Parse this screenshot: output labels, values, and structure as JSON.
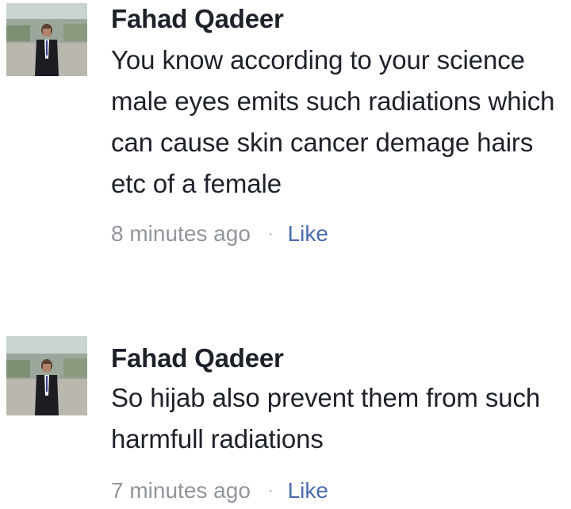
{
  "comments": [
    {
      "author": "Fahad Qadeer",
      "avatar_icon": "profile-photo-man-in-suit",
      "text": "You know according to your science male eyes emits such radiations which can cause skin cancer demage hairs etc of a female",
      "time": "8 minutes ago",
      "separator": "·",
      "like_label": "Like"
    },
    {
      "author": "Fahad Qadeer",
      "avatar_icon": "profile-photo-man-in-suit",
      "text": "So hijab also prevent them from such harmfull radiations",
      "time": "7 minutes ago",
      "separator": "·",
      "like_label": "Like"
    }
  ],
  "colors": {
    "text": "#1d2129",
    "meta": "#90949c",
    "link": "#4b6bb0"
  }
}
